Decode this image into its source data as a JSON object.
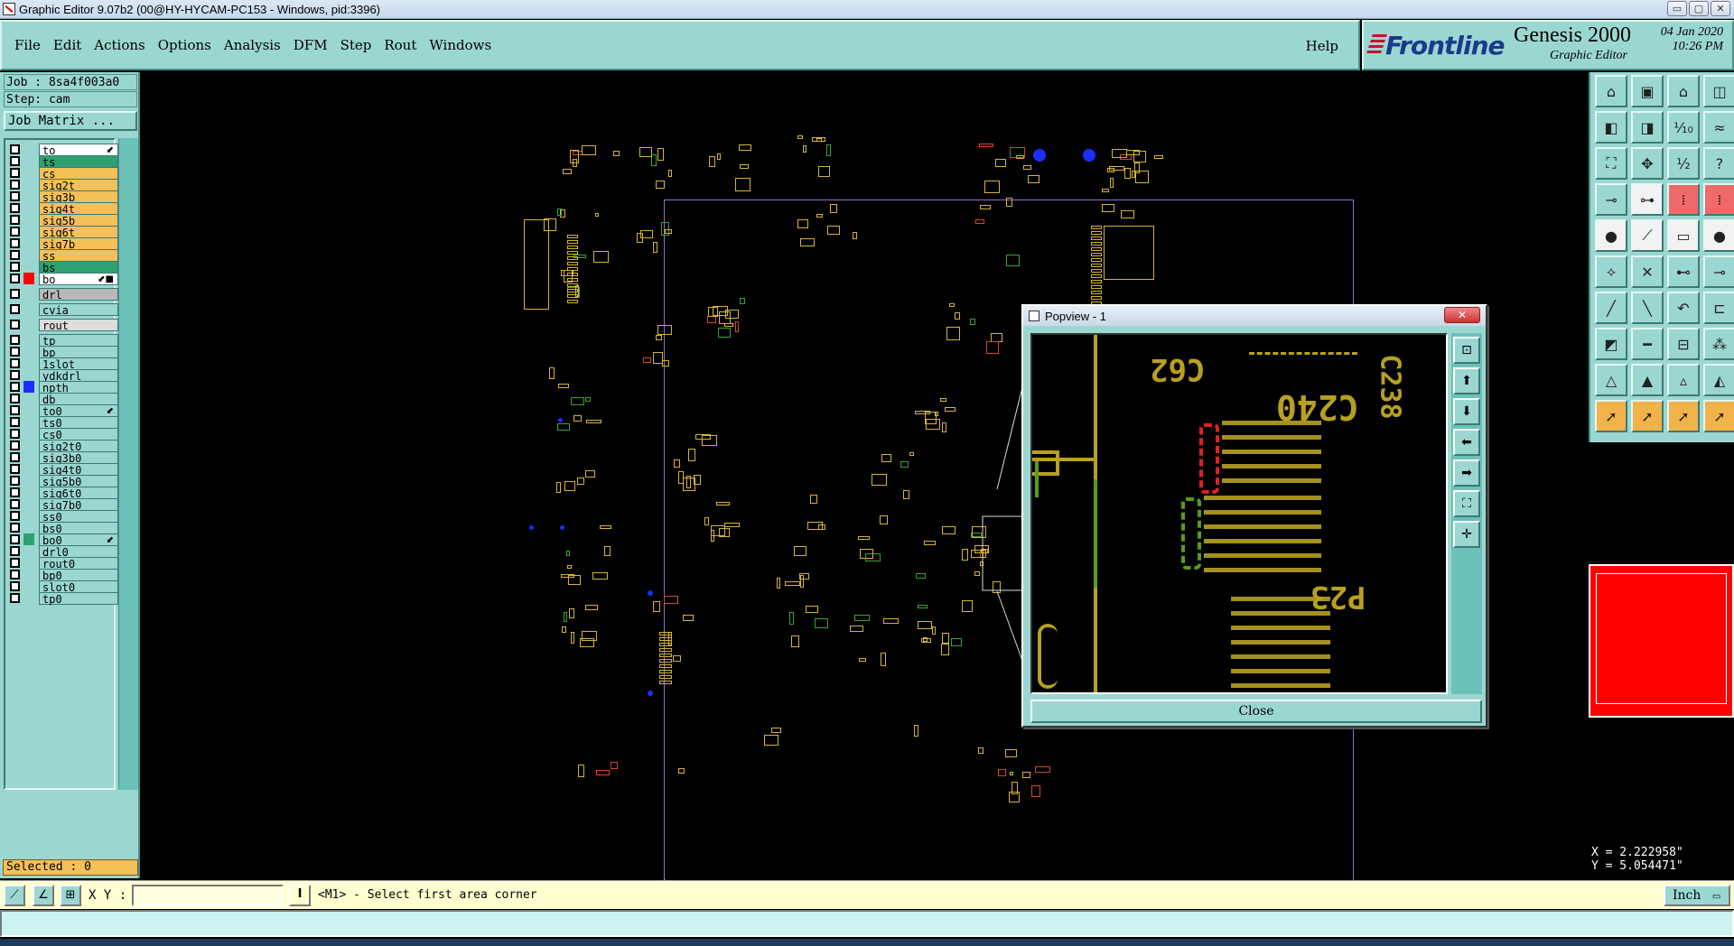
{
  "window": {
    "title": "Graphic Editor 9.07b2 (00@HY-HYCAM-PC153 - Windows, pid:3396)",
    "min_glyph": "▭",
    "max_glyph": "▢",
    "close_glyph": "✕"
  },
  "menu": {
    "items": [
      "File",
      "Edit",
      "Actions",
      "Options",
      "Analysis",
      "DFM",
      "Step",
      "Rout",
      "Windows"
    ],
    "help": "Help"
  },
  "logo": {
    "brand": "Frontline",
    "product": "Genesis 2000",
    "subtitle": "Graphic Editor",
    "date": "04 Jan 2020",
    "time": "10:26 PM"
  },
  "job": {
    "job": "Job : 8sa4f003a0",
    "step": "Step: cam",
    "matrix_button": "Job Matrix ..."
  },
  "layers": [
    {
      "name": "to",
      "bg": "#ffffff",
      "color": "",
      "mark": "⬋"
    },
    {
      "name": "ts",
      "bg": "#2fa06f",
      "color": "",
      "mark": ""
    },
    {
      "name": "cs",
      "bg": "#f4c05a",
      "color": "",
      "mark": ""
    },
    {
      "name": "sig2t",
      "bg": "#f4c05a",
      "color": "",
      "mark": ""
    },
    {
      "name": "sig3b",
      "bg": "#f4c05a",
      "color": "",
      "mark": ""
    },
    {
      "name": "sig4t",
      "bg": "#f4c05a",
      "color": "",
      "mark": ""
    },
    {
      "name": "sig5b",
      "bg": "#f4c05a",
      "color": "",
      "mark": ""
    },
    {
      "name": "sig6t",
      "bg": "#f4c05a",
      "color": "",
      "mark": ""
    },
    {
      "name": "sig7b",
      "bg": "#f4c05a",
      "color": "",
      "mark": ""
    },
    {
      "name": "ss",
      "bg": "#f4c05a",
      "color": "",
      "mark": ""
    },
    {
      "name": "bs",
      "bg": "#2fa06f",
      "color": "",
      "mark": ""
    },
    {
      "name": "bo",
      "bg": "#ffffff",
      "color": "#ff0000",
      "mark": "⬋■"
    },
    {
      "name": "drl",
      "bg": "#b8b8b8",
      "color": "",
      "mark": ""
    },
    {
      "name": "cvia",
      "bg": "#9bd7d1",
      "color": "",
      "mark": ""
    },
    {
      "name": "rout",
      "bg": "#dddddd",
      "color": "",
      "mark": ""
    },
    {
      "name": "tp",
      "bg": "#9bd7d1",
      "color": "",
      "mark": ""
    },
    {
      "name": "bp",
      "bg": "#9bd7d1",
      "color": "",
      "mark": ""
    },
    {
      "name": "1slot",
      "bg": "#9bd7d1",
      "color": "",
      "mark": ""
    },
    {
      "name": "ydkdrl",
      "bg": "#9bd7d1",
      "color": "",
      "mark": ""
    },
    {
      "name": "npth",
      "bg": "#9bd7d1",
      "color": "#1a2eff",
      "mark": ""
    },
    {
      "name": "db",
      "bg": "#9bd7d1",
      "color": "",
      "mark": ""
    },
    {
      "name": "to0",
      "bg": "#9bd7d1",
      "color": "",
      "mark": "⬋"
    },
    {
      "name": "ts0",
      "bg": "#9bd7d1",
      "color": "",
      "mark": ""
    },
    {
      "name": "cs0",
      "bg": "#9bd7d1",
      "color": "",
      "mark": ""
    },
    {
      "name": "sig2t0",
      "bg": "#9bd7d1",
      "color": "",
      "mark": ""
    },
    {
      "name": "sig3b0",
      "bg": "#9bd7d1",
      "color": "",
      "mark": ""
    },
    {
      "name": "sig4t0",
      "bg": "#9bd7d1",
      "color": "",
      "mark": ""
    },
    {
      "name": "sig5b0",
      "bg": "#9bd7d1",
      "color": "",
      "mark": ""
    },
    {
      "name": "sig6t0",
      "bg": "#9bd7d1",
      "color": "",
      "mark": ""
    },
    {
      "name": "sig7b0",
      "bg": "#9bd7d1",
      "color": "",
      "mark": ""
    },
    {
      "name": "ss0",
      "bg": "#9bd7d1",
      "color": "",
      "mark": ""
    },
    {
      "name": "bs0",
      "bg": "#9bd7d1",
      "color": "",
      "mark": ""
    },
    {
      "name": "bo0",
      "bg": "#9bd7d1",
      "color": "#2fa06f",
      "mark": "⬋"
    },
    {
      "name": "drl0",
      "bg": "#9bd7d1",
      "color": "",
      "mark": ""
    },
    {
      "name": "rout0",
      "bg": "#9bd7d1",
      "color": "",
      "mark": ""
    },
    {
      "name": "bp0",
      "bg": "#9bd7d1",
      "color": "",
      "mark": ""
    },
    {
      "name": "slot0",
      "bg": "#9bd7d1",
      "color": "",
      "mark": ""
    },
    {
      "name": "tp0",
      "bg": "#9bd7d1",
      "color": "",
      "mark": ""
    }
  ],
  "status": {
    "selected": "Selected : 0",
    "coord_x": "X = 2.222958\"",
    "coord_y": "Y = 5.054471\""
  },
  "command": {
    "xy_label": "X Y :",
    "xy_value": "",
    "bar_glyph": "I",
    "prompt": "<M1> - Select first area corner",
    "unit": "Inch",
    "unit_glyph": "▭"
  },
  "popview": {
    "title": "Popview - 1",
    "close_label": "Close",
    "close_glyph": "✕",
    "zoom_labels": {
      "c62": "C62",
      "c240": "C240",
      "c238": "C238",
      "p23": "P23"
    }
  },
  "colors": {
    "panel": "#9bd7d1",
    "copper": "#d6b43a",
    "board_outline": "#8f6fc7",
    "overview": "#ff0000"
  }
}
